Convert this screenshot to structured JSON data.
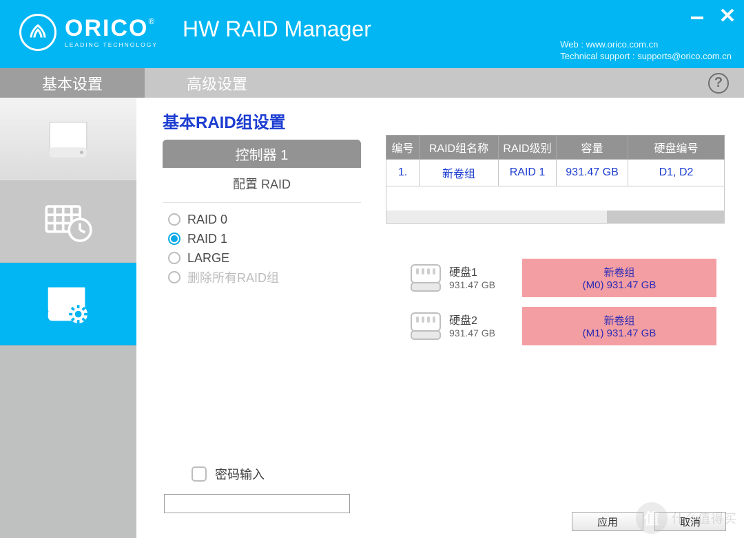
{
  "brand": {
    "name": "ORICO",
    "reg": "®",
    "tagline": "LEADING  TECHNOLOGY"
  },
  "app_title": "HW RAID Manager",
  "contact": {
    "web_label": "Web : www.orico.com.cn",
    "support_label": "Technical support : supports@orico.com.cn"
  },
  "tabs": {
    "basic": "基本设置",
    "advanced": "高级设置"
  },
  "section_title": "基本RAID组设置",
  "controller": {
    "title": "控制器 1",
    "subtitle": "配置 RAID"
  },
  "raid_options": {
    "raid0": "RAID 0",
    "raid1": "RAID 1",
    "large": "LARGE",
    "delete_all": "删除所有RAID组"
  },
  "table": {
    "headers": {
      "index": "编号",
      "name": "RAID组名称",
      "level": "RAID级别",
      "capacity": "容量",
      "disks": "硬盘编号"
    },
    "rows": [
      {
        "index": "1.",
        "name": "新卷组",
        "level": "RAID 1",
        "capacity": "931.47 GB",
        "disks": "D1, D2"
      }
    ]
  },
  "disks": [
    {
      "name": "硬盘1",
      "capacity": "931.47 GB",
      "vol_name": "新卷组",
      "vol_detail": "(M0) 931.47 GB"
    },
    {
      "name": "硬盘2",
      "capacity": "931.47 GB",
      "vol_name": "新卷组",
      "vol_detail": "(M1) 931.47 GB"
    }
  ],
  "password_label": "密码输入",
  "buttons": {
    "apply": "应用",
    "cancel": "取消"
  },
  "watermark": {
    "glyph": "值",
    "text": "什么值得买"
  }
}
